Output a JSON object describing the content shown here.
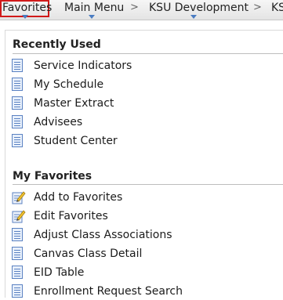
{
  "nav": {
    "favorites": "Favorites",
    "main_menu": "Main Menu",
    "ksu_dev": "KSU Development",
    "truncated": "KS",
    "separator": ">"
  },
  "recently_used": {
    "title": "Recently Used",
    "items": [
      {
        "label": "Service Indicators",
        "icon": "document-icon"
      },
      {
        "label": "My Schedule",
        "icon": "document-icon"
      },
      {
        "label": "Master Extract",
        "icon": "document-icon"
      },
      {
        "label": "Advisees",
        "icon": "document-icon"
      },
      {
        "label": "Student Center",
        "icon": "document-icon"
      }
    ]
  },
  "my_favorites": {
    "title": "My Favorites",
    "items": [
      {
        "label": "Add to Favorites",
        "icon": "edit-pencil-icon"
      },
      {
        "label": "Edit Favorites",
        "icon": "edit-pencil-icon"
      },
      {
        "label": "Adjust Class Associations",
        "icon": "document-icon"
      },
      {
        "label": "Canvas Class Detail",
        "icon": "document-icon"
      },
      {
        "label": "EID Table",
        "icon": "document-icon"
      },
      {
        "label": "Enrollment Request Search",
        "icon": "document-icon"
      }
    ]
  },
  "colors": {
    "highlight_border": "#d11a1a",
    "caret": "#4a7cc2",
    "doc_icon": "#5b82c2"
  }
}
